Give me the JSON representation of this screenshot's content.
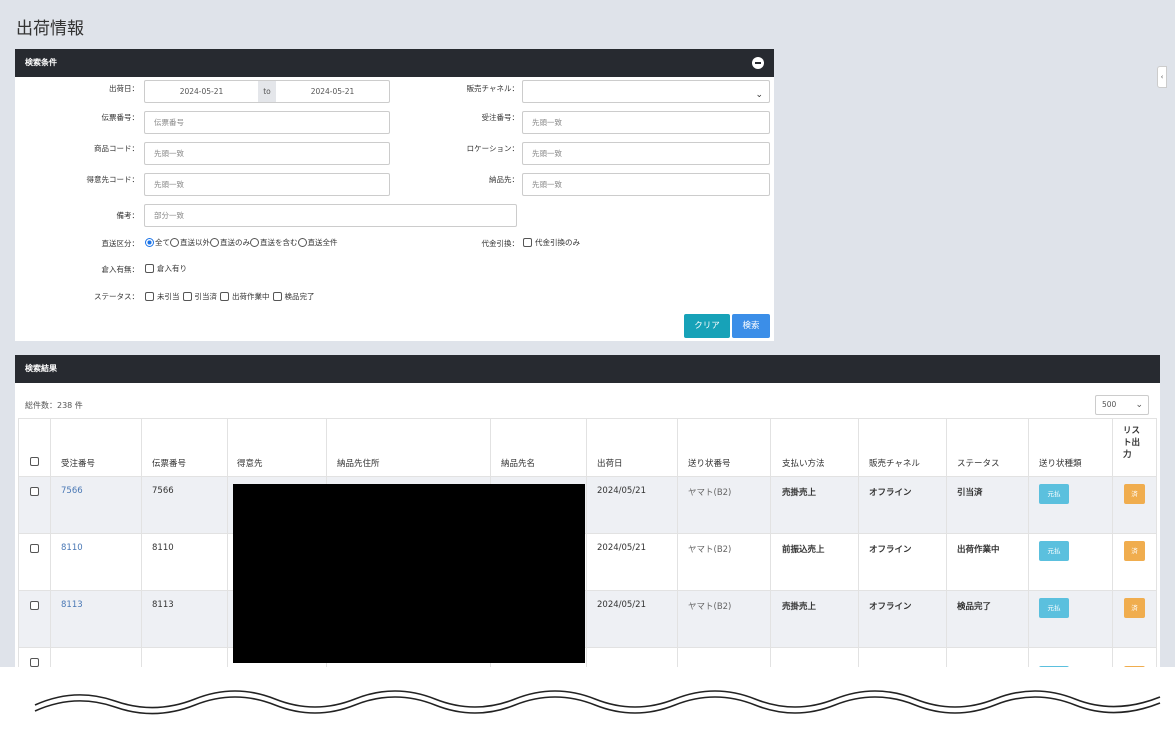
{
  "page": {
    "title": "出荷情報"
  },
  "search": {
    "header": "検索条件",
    "fields": {
      "ship_date_label": "出荷日：",
      "ship_date_from": "2024-05-21",
      "ship_date_to_label": "to",
      "ship_date_to": "2024-05-21",
      "sales_channel_label": "販売チャネル：",
      "slip_no_label": "伝票番号：",
      "slip_no_placeholder": "伝票番号",
      "order_no_label": "受注番号：",
      "order_no_placeholder": "先頭一致",
      "product_code_label": "商品コード：",
      "product_code_placeholder": "先頭一致",
      "location_label": "ロケーション：",
      "location_placeholder": "先頭一致",
      "customer_code_label": "得意先コード：",
      "customer_code_placeholder": "先頭一致",
      "delivery_label": "納品先：",
      "delivery_placeholder": "先頭一致",
      "remarks_label": "備考：",
      "remarks_placeholder": "部分一致",
      "direct_label": "直送区分：",
      "direct_options": [
        "全て",
        "直送以外",
        "直送のみ",
        "直送を含む",
        "直送全件"
      ],
      "cod_label": "代金引換：",
      "cod_option": "代金引換のみ",
      "storage_label": "倉入有無：",
      "storage_option": "倉入有り",
      "status_label": "ステータス：",
      "status_options": [
        "未引当",
        "引当済",
        "出荷作業中",
        "検品完了"
      ]
    },
    "clear_button": "クリア",
    "search_button": "検索"
  },
  "results": {
    "header": "検索結果",
    "total": "総件数：238 件",
    "page_size": "500",
    "columns": [
      "受注番号",
      "伝票番号",
      "得意先",
      "納品先住所",
      "納品先名",
      "出荷日",
      "送り状番号",
      "支払い方法",
      "販売チャネル",
      "ステータス",
      "送り状種類",
      "リスト出力"
    ],
    "rows": [
      {
        "order_no": "7566",
        "slip_no": "7566",
        "ship_date": "2024/05/21",
        "invoice": "ヤマト(B2)",
        "payment": "売掛売上",
        "channel": "オフライン",
        "status": "引当済",
        "invoice_type": "元払",
        "list": "済"
      },
      {
        "order_no": "8110",
        "slip_no": "8110",
        "ship_date": "2024/05/21",
        "invoice": "ヤマト(B2)",
        "payment": "前振込売上",
        "channel": "オフライン",
        "status": "出荷作業中",
        "invoice_type": "元払",
        "list": "済"
      },
      {
        "order_no": "8113",
        "slip_no": "8113",
        "ship_date": "2024/05/21",
        "invoice": "ヤマト(B2)",
        "payment": "売掛売上",
        "channel": "オフライン",
        "status": "検品完了",
        "invoice_type": "元払",
        "list": "済"
      }
    ]
  },
  "colors": {
    "header_bg": "#272a30",
    "clear_btn": "#17a2b8",
    "search_btn": "#3b8ee8",
    "badge_blue": "#5bc0de",
    "badge_orange": "#f0ad4e",
    "link": "#4a78b5"
  }
}
